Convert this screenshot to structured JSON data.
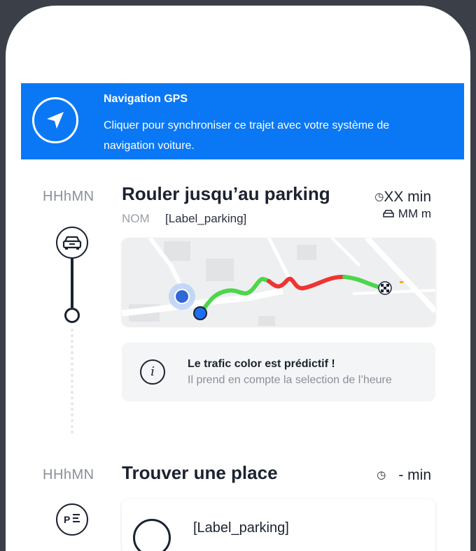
{
  "gps_banner": {
    "title": "Navigation GPS",
    "text": "Cliquer pour synchroniser ce trajet avec votre système de navigation voiture.",
    "color": "#0a78f5"
  },
  "step1": {
    "time": "HHhMN",
    "title": "Rouler jusqu’au parking",
    "duration": "XX min",
    "distance": "MM m",
    "name_prefix": "NOM",
    "name_label": "[Label_parking]",
    "icon": "car-icon"
  },
  "info": {
    "title": "Le trafic color est prédictif !",
    "text": "Il prend en compte la selection de l’heure",
    "icon": "info-icon"
  },
  "step2": {
    "time": "HHhMN",
    "title": "Trouver une place",
    "duration": "- min",
    "icon": "parking-search-icon",
    "card_label": "[Label_parking]"
  },
  "route_colors": {
    "green": "#4cd64c",
    "red": "#ee3434"
  }
}
